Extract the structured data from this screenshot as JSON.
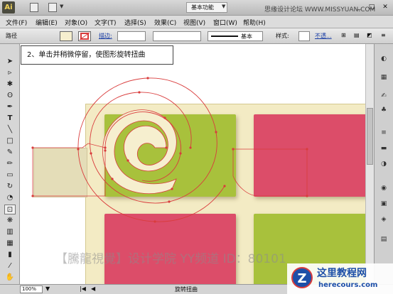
{
  "app": {
    "logo": "Ai",
    "workspace": "基本功能",
    "watermark_top": "思缘设计论坛 WWW.MISSYUAN.COM"
  },
  "menu": [
    "文件(F)",
    "编辑(E)",
    "对象(O)",
    "文字(T)",
    "选择(S)",
    "效果(C)",
    "视图(V)",
    "窗口(W)",
    "帮助(H)"
  ],
  "control": {
    "label": "路径",
    "stroke_label": "描边:",
    "stroke_style": "基本",
    "style_label": "样式:",
    "opacity_label": "不透..."
  },
  "callout": {
    "text": "2、单击并稍微停留，使图形旋转扭曲"
  },
  "watermark": {
    "text": "【騰龍視覺】设计学院  YY频道 ID：80101"
  },
  "status": {
    "zoom": "100%",
    "tool_name": "旋转扭曲"
  },
  "logo": {
    "mark": "Z",
    "title": "这里教程网",
    "url": "herecours.com"
  },
  "colors": {
    "artboard": "#f3ebc4",
    "green": "#a8c13c",
    "pink": "#dc4d69",
    "swirl": "#f6efcf",
    "anchor": "#d93c3c"
  },
  "icons": {
    "tools": [
      "selection-icon",
      "direct-selection-icon",
      "magic-wand-icon",
      "lasso-icon",
      "pen-icon",
      "type-icon",
      "line-icon",
      "rectangle-icon",
      "paintbrush-icon",
      "pencil-icon",
      "eraser-icon",
      "rotate-icon",
      "warp-icon",
      "free-transform-icon",
      "symbol-sprayer-icon",
      "graph-icon",
      "mesh-icon",
      "gradient-icon",
      "eyedropper-icon",
      "blend-icon",
      "scissors-icon",
      "hand-icon",
      "zoom-icon"
    ],
    "panels": [
      "color-icon",
      "swatches-icon",
      "brushes-icon",
      "symbols-icon",
      "stroke-icon",
      "gradient-panel-icon",
      "transparency-icon",
      "appearance-icon",
      "graphic-styles-icon",
      "layers-icon",
      "artboards-icon"
    ]
  }
}
